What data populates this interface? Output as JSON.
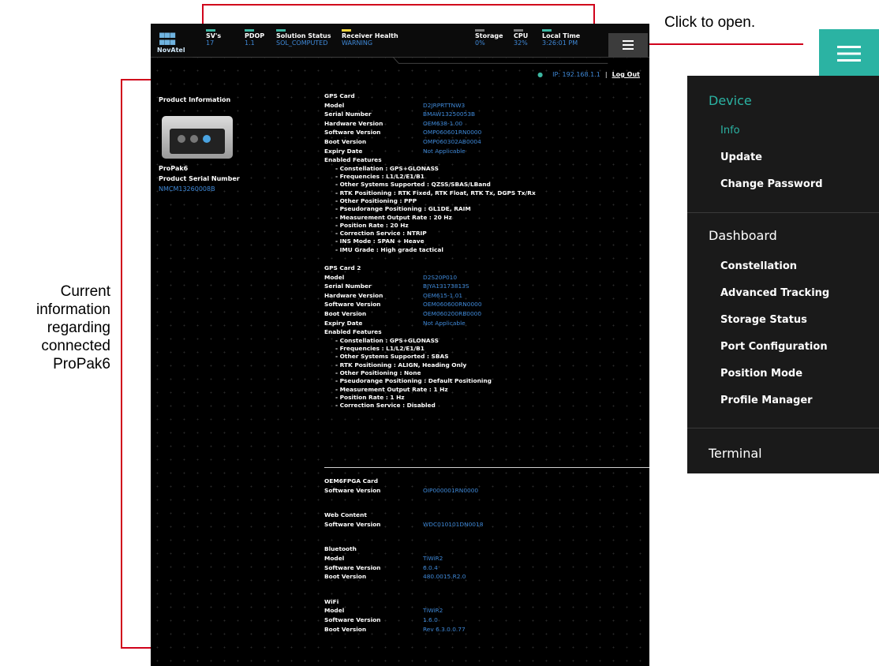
{
  "annotations": {
    "click_to_open": "Click to open.",
    "current_info": "Current information regarding connected ProPak6"
  },
  "header": {
    "logo_text": "NovAtel",
    "stats": [
      {
        "label": "SV's",
        "value": "17",
        "bar": "teal"
      },
      {
        "label": "PDOP",
        "value": "1.1",
        "bar": "teal"
      },
      {
        "label": "Solution Status",
        "value": "SOL_COMPUTED",
        "bar": "teal"
      },
      {
        "label": "Receiver Health",
        "value": "WARNING",
        "bar": "yellow"
      },
      {
        "label": "Storage",
        "value": "0%",
        "bar": "gray"
      },
      {
        "label": "CPU",
        "value": "32%",
        "bar": "gray"
      },
      {
        "label": "Local Time",
        "value": "3:26:01 PM",
        "bar": "teal"
      }
    ],
    "menu_icon": "hamburger-icon",
    "ip": "IP: 192.168.1.1",
    "separator": "|",
    "logout": "Log Out"
  },
  "product": {
    "heading": "Product Information",
    "name": "ProPak6",
    "serial_label": "Product Serial Number",
    "serial": "NMCM13260008B"
  },
  "gps1": {
    "title": "GPS Card",
    "rows": [
      {
        "k": "Model",
        "v": "D2JRPRTTNW3"
      },
      {
        "k": "Serial Number",
        "v": "BMAW13250053B"
      },
      {
        "k": "Hardware Version",
        "v": "OEM638-1.00"
      },
      {
        "k": "Software Version",
        "v": "OMP060601RN0000"
      },
      {
        "k": "Boot Version",
        "v": "OMP060302AB0004"
      },
      {
        "k": "Expiry Date",
        "v": "Not Applicable"
      },
      {
        "k": "Enabled Features",
        "v": ""
      }
    ],
    "features": [
      "Constellation : GPS+GLONASS",
      "Frequencies : L1/L2/E1/B1",
      "Other Systems Supported : QZSS/SBAS/LBand",
      "RTK Positioning : RTK Fixed, RTK Float, RTK Tx, DGPS Tx/Rx",
      "Other Positioning : PPP",
      "Pseudorange Positioning : GL1DE, RAIM",
      "Measurement Output Rate : 20 Hz",
      "Position Rate : 20 Hz",
      "Correction Service : NTRIP",
      "INS Mode : SPAN + Heave",
      "IMU Grade : High grade tactical"
    ]
  },
  "gps2": {
    "title": "GPS Card 2",
    "rows": [
      {
        "k": "Model",
        "v": "D2S20P010"
      },
      {
        "k": "Serial Number",
        "v": "BJYA13173813S"
      },
      {
        "k": "Hardware Version",
        "v": "OEM615-1.01"
      },
      {
        "k": "Software Version",
        "v": "OEM060600RN0000"
      },
      {
        "k": "Boot Version",
        "v": "OEM060200RB0000"
      },
      {
        "k": "Expiry Date",
        "v": "Not Applicable"
      },
      {
        "k": "Enabled Features",
        "v": ""
      }
    ],
    "features": [
      "Constellation : GPS+GLONASS",
      "Frequencies : L1/L2/E1/B1",
      "Other Systems Supported : SBAS",
      "RTK Positioning : ALIGN, Heading Only",
      "Other Positioning : None",
      "Pseudorange Positioning : Default Positioning",
      "Measurement Output Rate : 1 Hz",
      "Position Rate : 1 Hz",
      "Correction Service : Disabled"
    ]
  },
  "fpga": {
    "title": "OEM6FPGA Card",
    "rows": [
      {
        "k": "Software Version",
        "v": "OIP000001RN0000"
      }
    ]
  },
  "web": {
    "title": "Web Content",
    "rows": [
      {
        "k": "Software Version",
        "v": "WDC010101DN0018"
      }
    ]
  },
  "bt": {
    "title": "Bluetooth",
    "rows": [
      {
        "k": "Model",
        "v": "TiWiR2"
      },
      {
        "k": "Software Version",
        "v": "6.0.4"
      },
      {
        "k": "Boot Version",
        "v": "480.0015.R2.0"
      }
    ]
  },
  "wifi": {
    "title": "WiFi",
    "rows": [
      {
        "k": "Model",
        "v": "TiWiR2"
      },
      {
        "k": "Software Version",
        "v": "1.6.0"
      },
      {
        "k": "Boot Version",
        "v": "Rev 6.3.0.0.77"
      }
    ]
  },
  "menu_panel": {
    "device": "Device",
    "device_items": [
      "Info",
      "Update",
      "Change Password"
    ],
    "dashboard": "Dashboard",
    "dashboard_items": [
      "Constellation",
      "Advanced Tracking",
      "Storage Status",
      "Port Configuration",
      "Position Mode",
      "Profile Manager"
    ],
    "terminal": "Terminal"
  },
  "colors": {
    "accent": "#2bb3a3",
    "link": "#3f89d8",
    "warn": "#f1d33b",
    "annotation": "#d0021b"
  }
}
